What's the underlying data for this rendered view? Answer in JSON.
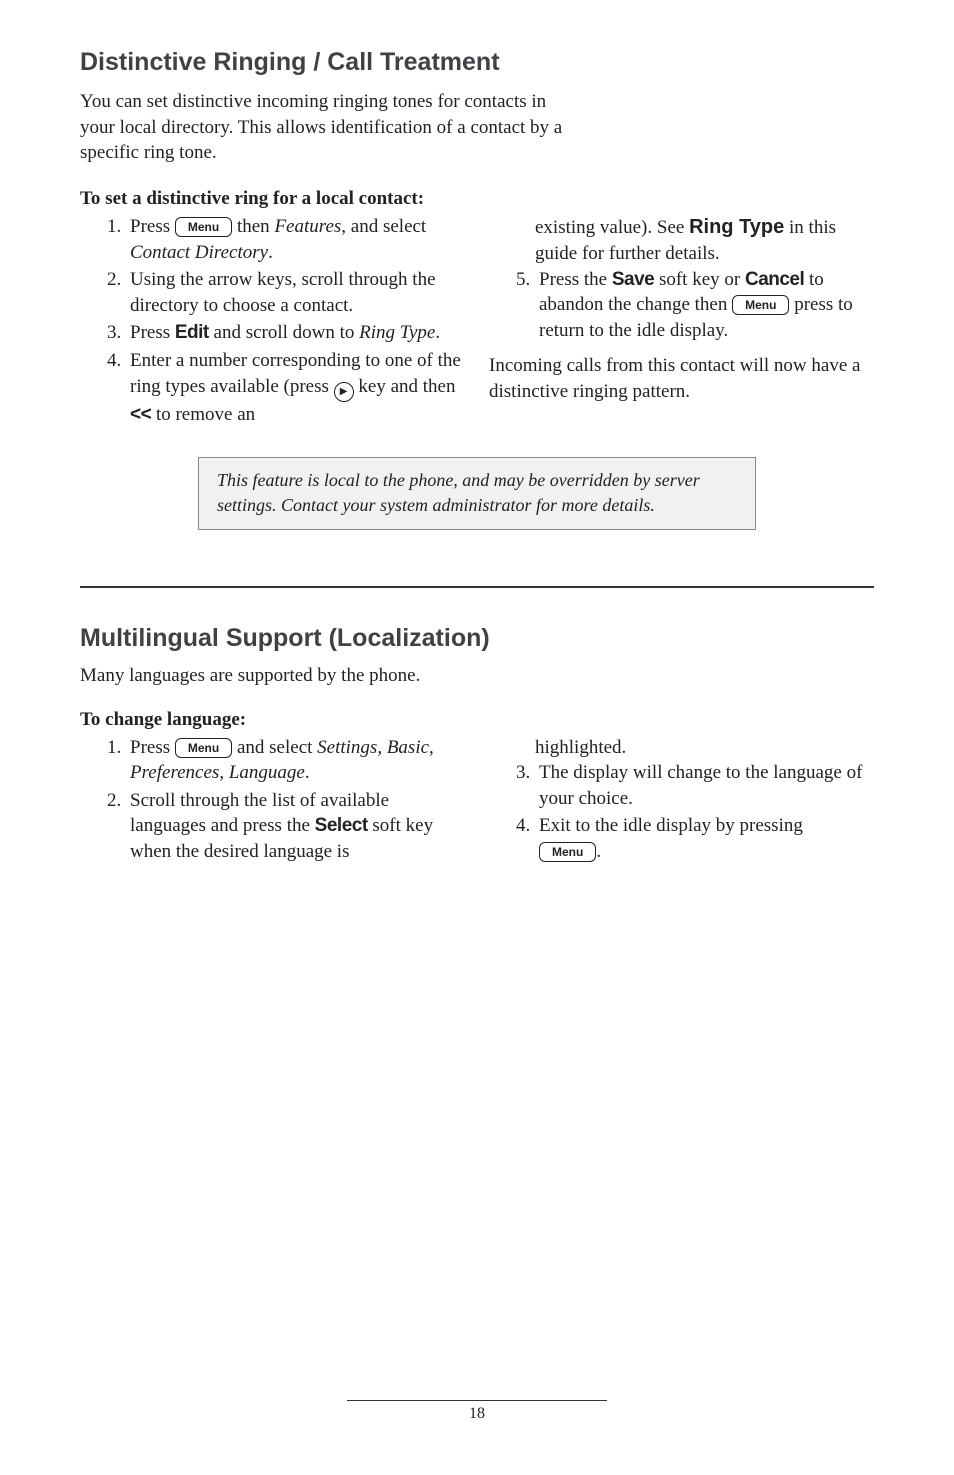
{
  "s1": {
    "heading": "Distinctive Ringing / Call Treatment",
    "intro": "You can set distinctive incoming ringing tones for contacts in your local directory.  This allows identification of a contact by a specific ring tone.",
    "subhead": "To set a distinctive ring for a local contact:",
    "left": {
      "li1_a": "Press ",
      "li1_b": " then ",
      "li1_c": "Features,",
      "li1_d": " and select ",
      "li1_e": "Contact Directory",
      "li1_f": ".",
      "li2": "Using the arrow keys, scroll through the directory to choose a contact.",
      "li3_a": "Press ",
      "li3_b": "Edit",
      "li3_c": " and scroll down to ",
      "li3_d": "Ring Type",
      "li3_e": ".",
      "li4_a": "Enter a number corresponding to one of the ring types available (press ",
      "li4_b": " key and then ",
      "li4_c": "<<",
      "li4_d": " to remove an"
    },
    "right": {
      "cont_a": "existing value).  See ",
      "cont_b": "Ring Type",
      "cont_c": " in this guide for further details.",
      "li5_a": "Press the ",
      "li5_b": "Save",
      "li5_c": " soft key or ",
      "li5_d": "Cancel",
      "li5_e": " to abandon the change then ",
      "li5_f": " press  to return to the idle display.",
      "tail": "Incoming calls from this contact will now have a distinctive ringing pattern."
    },
    "note": "This feature is local to the phone, and may be overridden by server settings.  Contact your system administrator for more details."
  },
  "s2": {
    "heading": "Multilingual Support (Localization)",
    "intro": "Many languages are supported by the phone.",
    "subhead": "To change language:",
    "left": {
      "li1_a": "Press ",
      "li1_b": " and select ",
      "li1_c": "Settings, Basic, Preferences, Language",
      "li1_d": ".",
      "li2_a": "Scroll through the list of available languages and press the ",
      "li2_b": "Select",
      "li2_c": " soft key when the desired language is"
    },
    "right": {
      "cont": "highlighted.",
      "li3": "The display will change to the language of your choice.",
      "li4_a": "Exit to the idle display by pressing ",
      "li4_b": "."
    }
  },
  "menu": "Menu",
  "pagenum": "18"
}
